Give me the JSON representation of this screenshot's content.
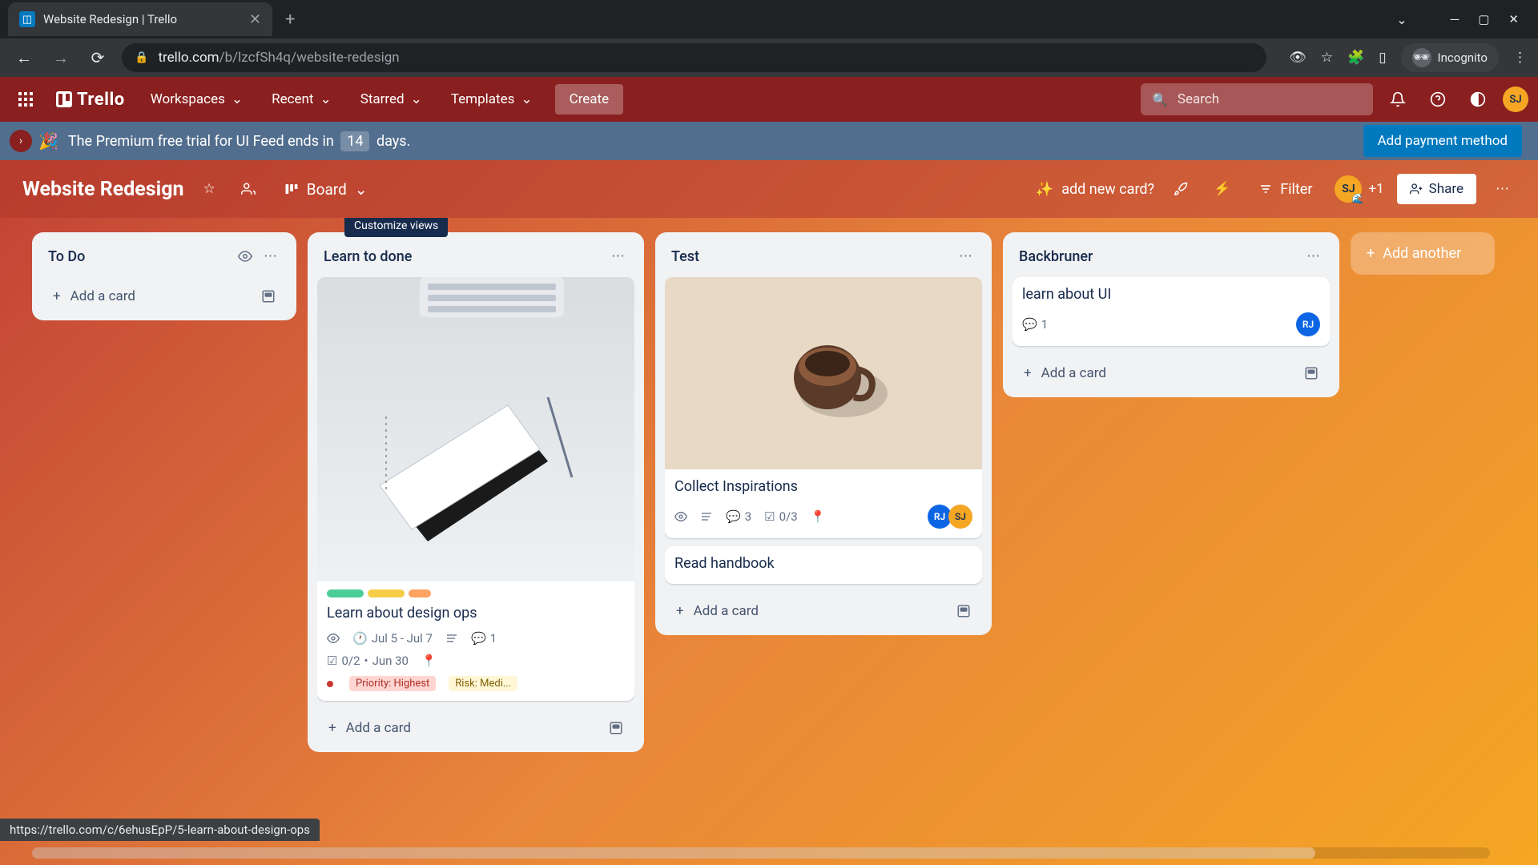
{
  "browser": {
    "tab_title": "Website Redesign | Trello",
    "url_domain": "trello.com",
    "url_path": "/b/lzcfSh4q/website-redesign",
    "incognito_label": "Incognito"
  },
  "trello_header": {
    "logo_text": "Trello",
    "nav": [
      "Workspaces",
      "Recent",
      "Starred",
      "Templates"
    ],
    "create_label": "Create",
    "search_placeholder": "Search",
    "avatar_initials": "SJ"
  },
  "premium_banner": {
    "text_before": "The Premium free trial for UI Feed ends in",
    "days": "14",
    "text_after": "days.",
    "cta": "Add payment method"
  },
  "board_header": {
    "board_name": "Website Redesign",
    "view_label": "Board",
    "sparkle_text": "add new card?",
    "filter_label": "Filter",
    "member_initials": "SJ",
    "plus_count": "+1",
    "share_label": "Share",
    "tooltip": "Customize views"
  },
  "lists": [
    {
      "title": "To Do",
      "watching": true,
      "cards": [],
      "add_label": "Add a card"
    },
    {
      "title": "Learn to done",
      "cards": [
        {
          "cover": "notebook",
          "labels": [
            "#4bce97",
            "#f5cd47",
            "#fea362"
          ],
          "title": "Learn about design ops",
          "watching": true,
          "date": "Jul 5 - Jul 7",
          "has_desc": true,
          "comments": 1,
          "checklist": "0/2",
          "due": "Jun 30",
          "has_location": true,
          "chips": [
            {
              "color": "red",
              "text": "Priority: Highest"
            },
            {
              "color": "yellow",
              "text": "Risk: Medi..."
            }
          ]
        }
      ],
      "add_label": "Add a card"
    },
    {
      "title": "Test",
      "cards": [
        {
          "cover": "coffee",
          "title": "Collect Inspirations",
          "watching": true,
          "has_desc": true,
          "comments": 3,
          "checklist": "0/3",
          "has_location": true,
          "members": [
            {
              "initials": "RJ",
              "color": "blue"
            },
            {
              "initials": "SJ",
              "color": "orange"
            }
          ]
        },
        {
          "title": "Read handbook"
        }
      ],
      "add_label": "Add a card"
    },
    {
      "title": "Backbruner",
      "cards": [
        {
          "title": "learn about UI",
          "comments": 1,
          "members": [
            {
              "initials": "RJ",
              "color": "blue"
            }
          ]
        }
      ],
      "add_label": "Add a card"
    }
  ],
  "add_list_label": "Add another",
  "status_url": "https://trello.com/c/6ehusEpP/5-learn-about-design-ops"
}
